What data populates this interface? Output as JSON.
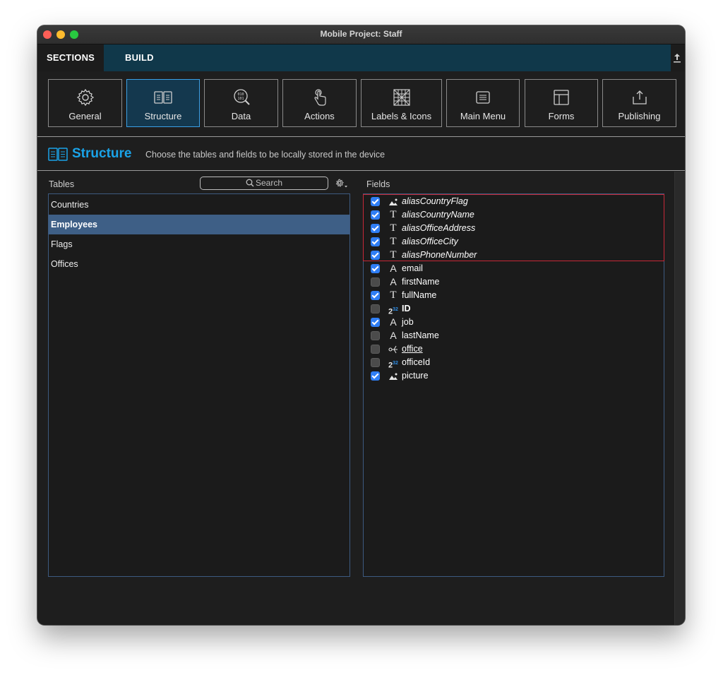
{
  "window": {
    "title": "Mobile Project: Staff"
  },
  "tabs": {
    "sections": "SECTIONS",
    "build": "BUILD"
  },
  "toolbar": {
    "buttons": [
      {
        "label": "General",
        "icon": "gear-icon"
      },
      {
        "label": "Structure",
        "icon": "structure-icon",
        "active": true
      },
      {
        "label": "Data",
        "icon": "data-icon"
      },
      {
        "label": "Actions",
        "icon": "hand-pointer-icon"
      },
      {
        "label": "Labels & Icons",
        "icon": "labels-icon"
      },
      {
        "label": "Main Menu",
        "icon": "menu-icon"
      },
      {
        "label": "Forms",
        "icon": "forms-icon"
      },
      {
        "label": "Publishing",
        "icon": "publish-icon"
      }
    ]
  },
  "header": {
    "title": "Structure",
    "description": "Choose the tables and fields to be locally stored in the device"
  },
  "tables": {
    "label": "Tables",
    "search_placeholder": "Search",
    "items": [
      "Countries",
      "Employees",
      "Flags",
      "Offices"
    ],
    "selected": "Employees"
  },
  "fields": {
    "label": "Fields",
    "items": [
      {
        "name": "aliasCountryFlag",
        "type": "picture",
        "checked": true,
        "style": "italic"
      },
      {
        "name": "aliasCountryName",
        "type": "text",
        "checked": true,
        "style": "italic"
      },
      {
        "name": "aliasOfficeAddress",
        "type": "text",
        "checked": true,
        "style": "italic"
      },
      {
        "name": "aliasOfficeCity",
        "type": "text",
        "checked": true,
        "style": "italic"
      },
      {
        "name": "aliasPhoneNumber",
        "type": "text",
        "checked": true,
        "style": "italic"
      },
      {
        "name": "email",
        "type": "alpha",
        "checked": true,
        "style": ""
      },
      {
        "name": "firstName",
        "type": "alpha",
        "checked": false,
        "style": ""
      },
      {
        "name": "fullName",
        "type": "text",
        "checked": true,
        "style": ""
      },
      {
        "name": "ID",
        "type": "integer",
        "checked": false,
        "style": "bold"
      },
      {
        "name": "job",
        "type": "alpha",
        "checked": true,
        "style": ""
      },
      {
        "name": "lastName",
        "type": "alpha",
        "checked": false,
        "style": ""
      },
      {
        "name": "office",
        "type": "relation",
        "checked": false,
        "style": "underline"
      },
      {
        "name": "officeId",
        "type": "integer",
        "checked": false,
        "style": ""
      },
      {
        "name": "picture",
        "type": "picture",
        "checked": true,
        "style": ""
      }
    ]
  },
  "colors": {
    "accent": "#1aa3e8",
    "selected_row": "#3e5f86",
    "checkbox_on": "#2f7ef5",
    "alias_outline": "#c72838",
    "build_tab": "#10384a"
  }
}
